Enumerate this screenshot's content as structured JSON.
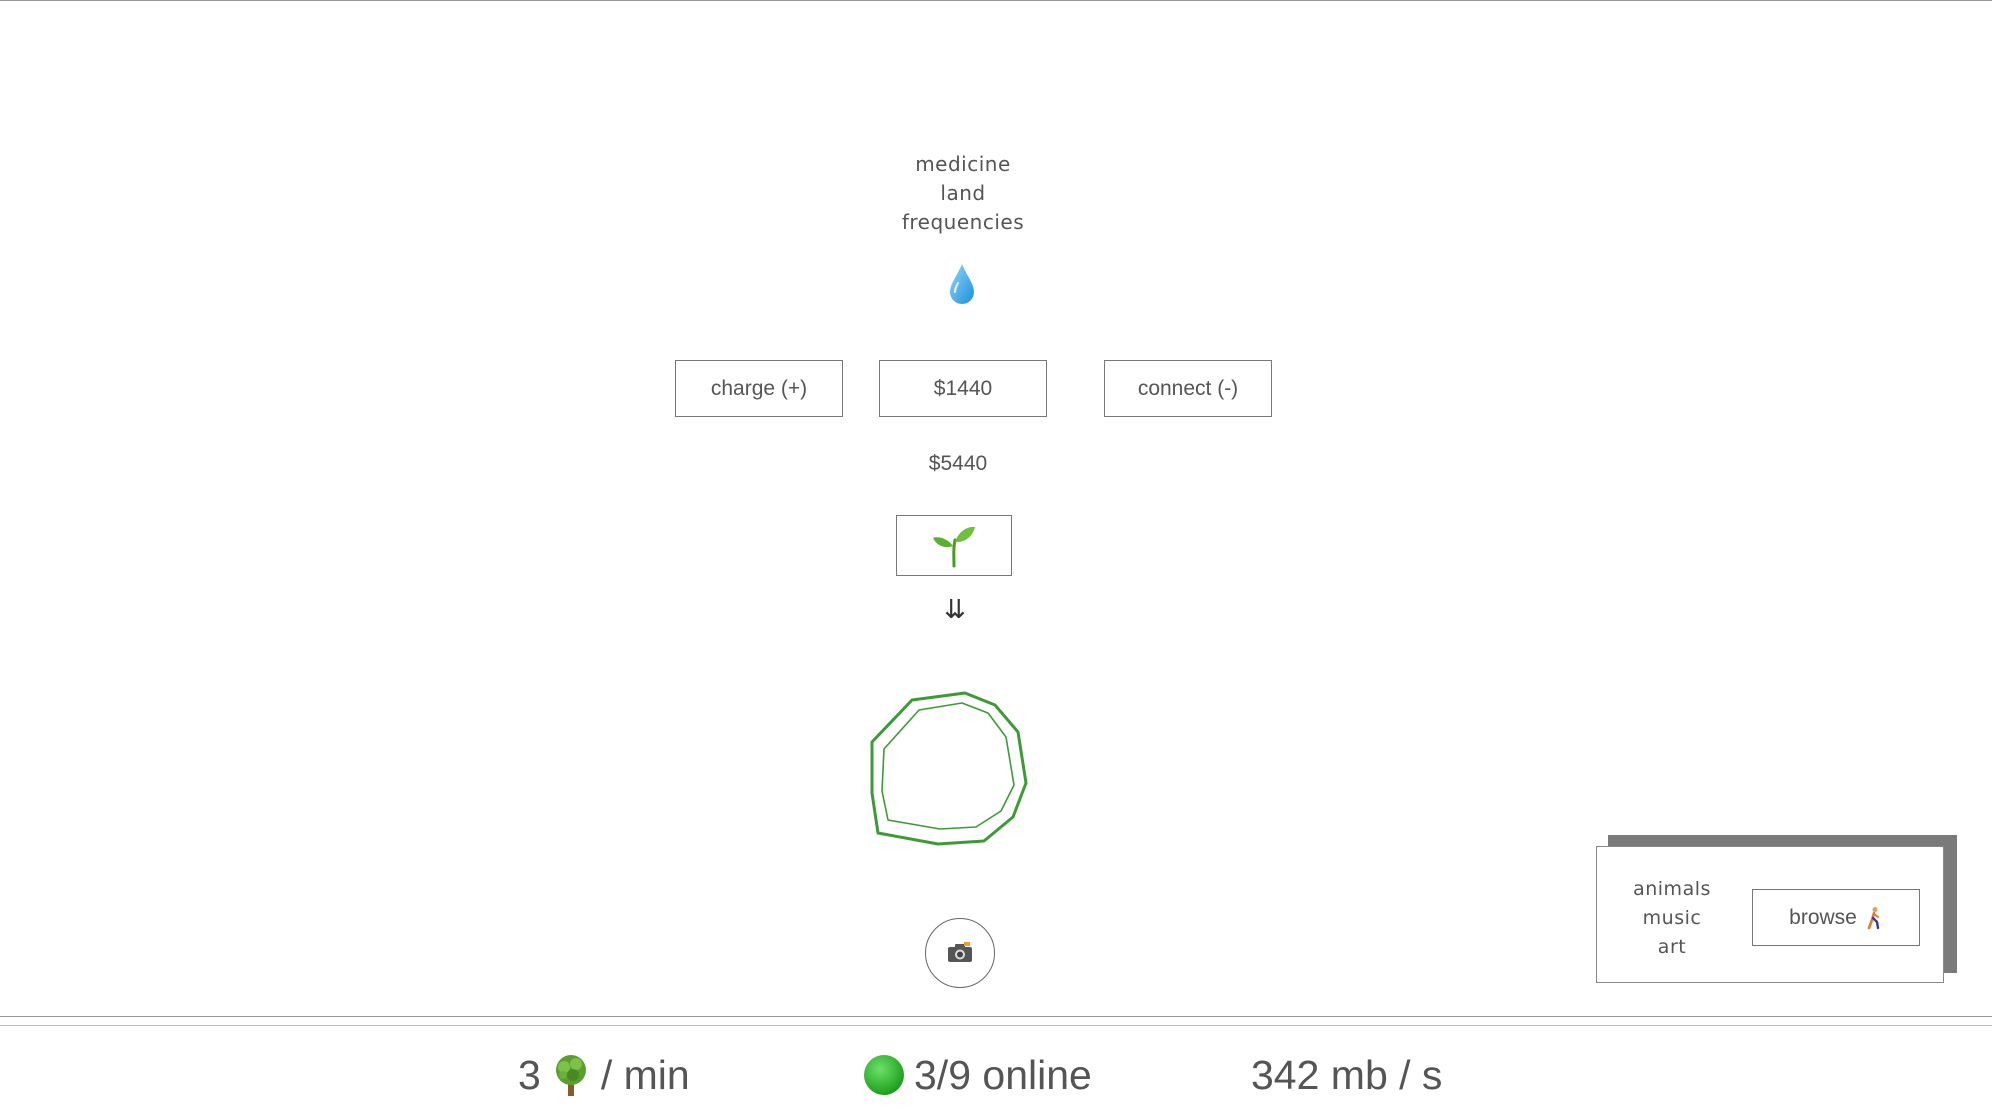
{
  "tags": [
    "medicine",
    "land",
    "frequencies"
  ],
  "icons": {
    "drop": "water-drop-icon",
    "seedling": "seedling-icon",
    "arrow": "double-down-arrow-icon",
    "camera": "camera-icon",
    "tree": "tree-icon",
    "online_dot": "green-circle-icon",
    "walker": "walking-person-icon"
  },
  "buttons": {
    "charge": "charge (+)",
    "price": "$1440",
    "connect": "connect (-)"
  },
  "total": "$5440",
  "arrow_glyph": "⇊",
  "panel": {
    "tags": [
      "animals",
      "music",
      "art"
    ],
    "browse_label": "browse"
  },
  "footer": {
    "rate_count": "3",
    "rate_unit": "/ min",
    "online": "3/9 online",
    "speed": "342 mb / s"
  },
  "colors": {
    "accent_green": "#3d9a36",
    "online_green": "#22b022",
    "drop_blue": "#2aa2e6",
    "panel_shadow": "#7a7a7a"
  }
}
